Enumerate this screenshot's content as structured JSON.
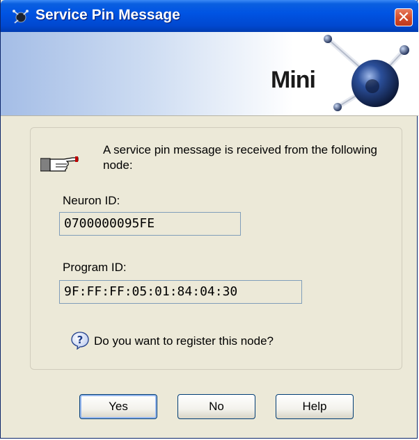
{
  "window": {
    "title": "Service Pin Message",
    "close_glyph": "✕"
  },
  "banner": {
    "product": "Mini"
  },
  "message": {
    "text": "A service pin message is received from the following node:",
    "icon": "pointing-hand-icon"
  },
  "neuron_id": {
    "label": "Neuron ID:",
    "value": "0700000095FE"
  },
  "program_id": {
    "label": "Program ID:",
    "value": "9F:FF:FF:05:01:84:04:30"
  },
  "question": {
    "text": "Do you want to register this node?",
    "icon": "question-icon"
  },
  "buttons": {
    "yes": "Yes",
    "no": "No",
    "help": "Help"
  },
  "colors": {
    "titlebar": "#0054e3",
    "dialog_bg": "#ece9d8",
    "close_button": "#d24b2a"
  }
}
